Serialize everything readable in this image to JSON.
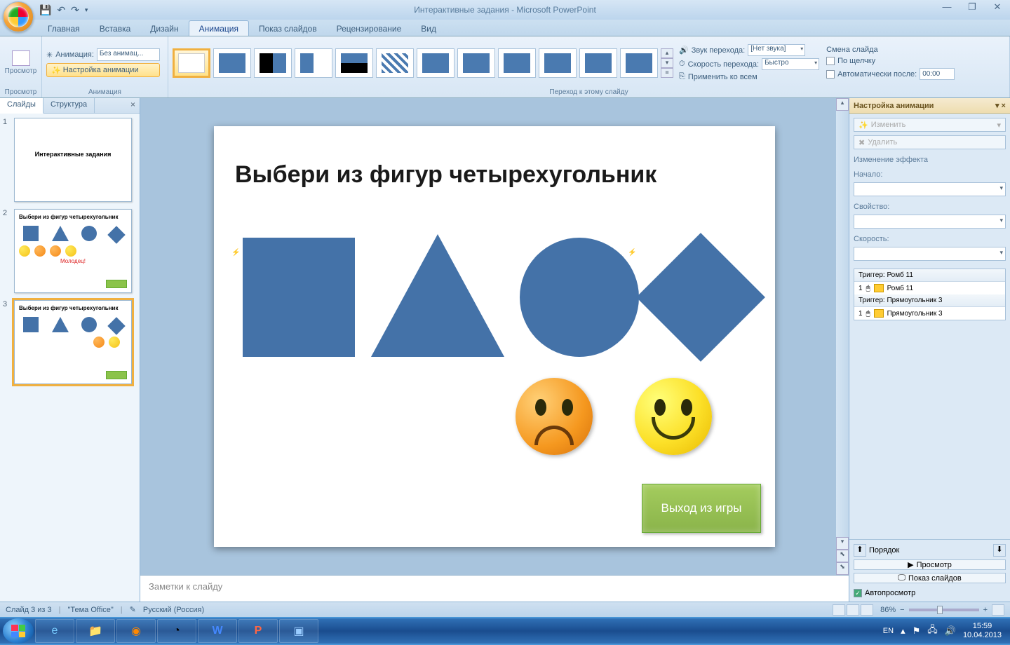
{
  "title": "Интерактивные задания - Microsoft PowerPoint",
  "tabs": {
    "home": "Главная",
    "insert": "Вставка",
    "design": "Дизайн",
    "animation": "Анимация",
    "slideshow": "Показ слайдов",
    "review": "Рецензирование",
    "view": "Вид"
  },
  "ribbon": {
    "preview": "Просмотр",
    "preview_grp": "Просмотр",
    "anim_label": "Анимация:",
    "anim_value": "Без анимац...",
    "custom_anim": "Настройка анимации",
    "anim_grp": "Анимация",
    "transition_grp": "Переход к этому слайду",
    "sound_label": "Звук перехода:",
    "sound_value": "[Нет звука]",
    "speed_label": "Скорость перехода:",
    "speed_value": "Быстро",
    "apply_all": "Применить ко всем",
    "advance_title": "Смена слайда",
    "on_click": "По щелчку",
    "auto_after": "Автоматически после:",
    "auto_time": "00:00"
  },
  "slides_tabs": {
    "slides": "Слайды",
    "outline": "Структура"
  },
  "thumbs": {
    "t1_title": "Интерактивные задания",
    "t2_title": "Выбери из фигур четырехугольник",
    "t2_molodec": "Молодец!",
    "t3_title": "Выбери из фигур четырехугольник"
  },
  "slide": {
    "title": "Выбери из фигур четырехугольник",
    "exit": "Выход из игры"
  },
  "notes_placeholder": "Заметки к слайду",
  "anim_pane": {
    "title": "Настройка анимации",
    "change": "Изменить",
    "delete": "Удалить",
    "effect_change": "Изменение эффекта",
    "start": "Начало:",
    "property": "Свойство:",
    "speed": "Скорость:",
    "trigger1": "Триггер: Ромб 11",
    "trigger1_item": "Ромб 11",
    "trigger2": "Триггер: Прямоугольник 3",
    "trigger2_item": "Прямоугольник 3",
    "order": "Порядок",
    "play": "Просмотр",
    "slideshow": "Показ слайдов",
    "autopreview": "Автопросмотр"
  },
  "status": {
    "slide": "Слайд 3 из 3",
    "theme": "\"Тема Office\"",
    "lang": "Русский (Россия)",
    "zoom": "86%"
  },
  "taskbar": {
    "lang": "EN",
    "time": "15:59",
    "date": "10.04.2013"
  }
}
